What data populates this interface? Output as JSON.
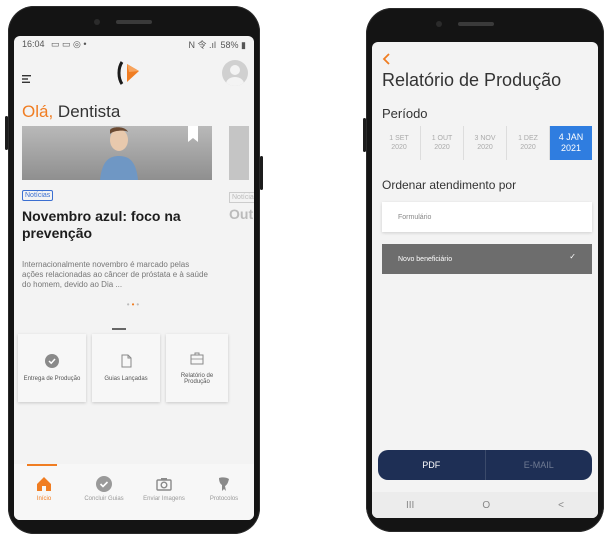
{
  "phone1": {
    "status": {
      "time": "16:04",
      "left_icons": "▭ ▭ ◎ •",
      "right_icons": "N 令 .ıl",
      "battery": "58%"
    },
    "menu_icon": "hamburger-icon",
    "greeting": {
      "highlight": "Olá,",
      "name": " Dentista"
    },
    "carousel": {
      "tag": "Notícias",
      "headline": "Novembro azul: foco na prevenção",
      "summary": "Internacionalmente novembro é marcado pelas ações relacionadas ao câncer de próstata e à saúde do homem, devido ao Dia ...",
      "peek_tag": "Notícias",
      "peek_headline": "Out"
    },
    "tiles": [
      {
        "label": "Entrega de Produção",
        "icon": "check-circle-icon"
      },
      {
        "label": "Guias Lançadas",
        "icon": "document-icon"
      },
      {
        "label": "Relatório de Produção",
        "icon": "briefcase-icon"
      }
    ],
    "nav": [
      {
        "label": "Início",
        "icon": "home-icon",
        "active": true
      },
      {
        "label": "Concluir Guias",
        "icon": "check-circle-icon"
      },
      {
        "label": "Enviar Imagens",
        "icon": "camera-icon"
      },
      {
        "label": "Protocolos",
        "icon": "tooth-icon"
      }
    ],
    "accent": "#f07d22"
  },
  "phone2": {
    "back_icon": "chevron-left-icon",
    "title": "Relatório de Produção",
    "periodo_label": "Período",
    "periods": [
      {
        "day": "1 SET",
        "year": "2020"
      },
      {
        "day": "1 OUT",
        "year": "2020"
      },
      {
        "day": "3 NOV",
        "year": "2020"
      },
      {
        "day": "1 DEZ",
        "year": "2020"
      },
      {
        "day": "4 JAN",
        "year": "2021",
        "selected": true
      }
    ],
    "ordenar_label": "Ordenar atendimento por",
    "options": [
      {
        "label": "Formulário",
        "selected": false
      },
      {
        "label": "Novo beneficiário",
        "selected": true
      }
    ],
    "pdf_label": "PDF",
    "email_label": "E-MAIL",
    "sysnav": {
      "recent": "III",
      "home": "O",
      "back": "<"
    },
    "selected_color": "#2f7de0",
    "button_bar_color": "#1e2f55"
  }
}
